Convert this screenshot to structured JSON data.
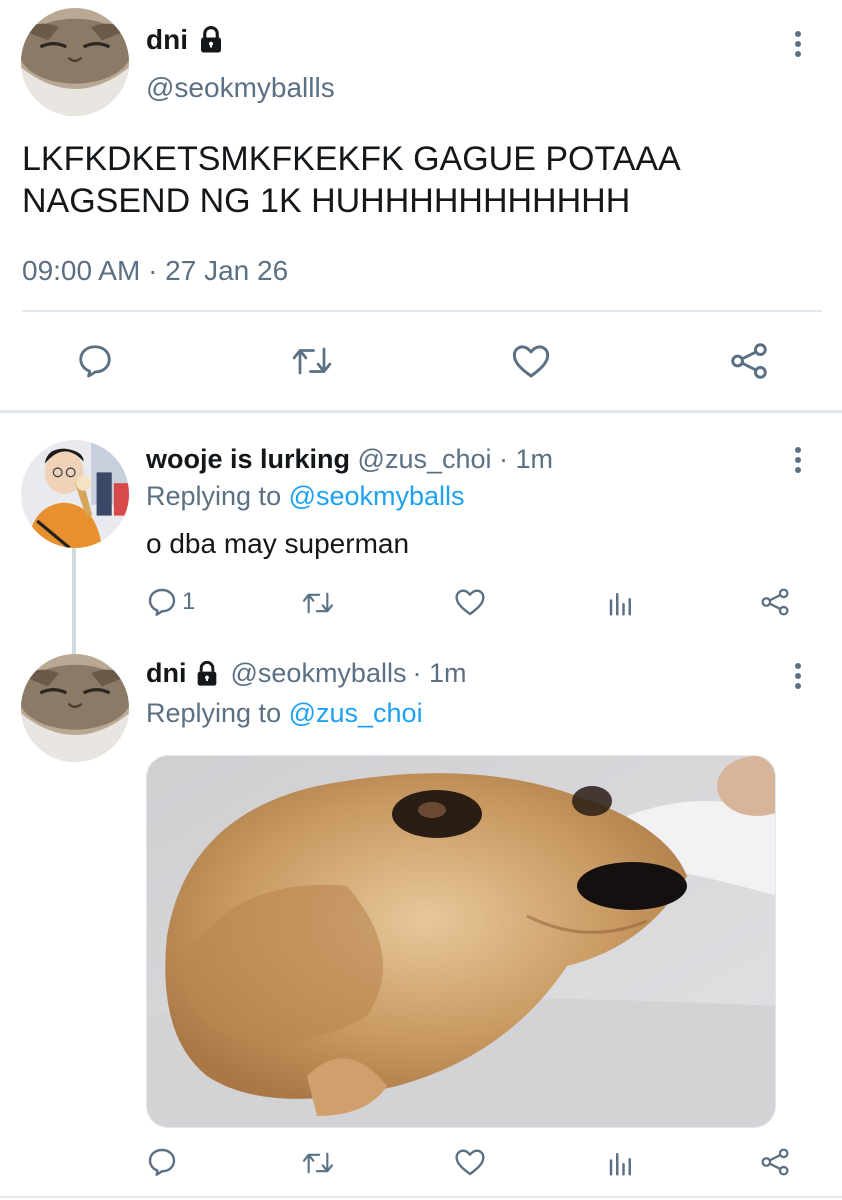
{
  "main_tweet": {
    "display_name": "dni",
    "handle": "@seokmyballls",
    "text_line1": "LKFKDKETSMKFKEKFK GAGUE POTAAA",
    "text_line2": "NAGSEND NG 1K HUHHHHHHHHHHH",
    "timestamp": "09:00 AM · 27 Jan 26"
  },
  "reply1": {
    "display_name": "wooje is lurking",
    "handle": "@zus_choi",
    "time": "· 1m",
    "replying_prefix": "Replying to ",
    "replying_to": "@seokmyballs",
    "text": "o dba may superman",
    "reply_count": "1"
  },
  "reply2": {
    "display_name": "dni",
    "handle": "@seokmyballs",
    "time": "· 1m",
    "replying_prefix": "Replying to ",
    "replying_to": "@zus_choi"
  },
  "colors": {
    "text": "#14171a",
    "secondary": "#5b7083",
    "link": "#1da1f2",
    "divider": "#e1e8ed"
  },
  "icons": [
    "lock-icon",
    "more-icon",
    "reply-icon",
    "retweet-icon",
    "like-icon",
    "share-icon",
    "analytics-icon"
  ]
}
